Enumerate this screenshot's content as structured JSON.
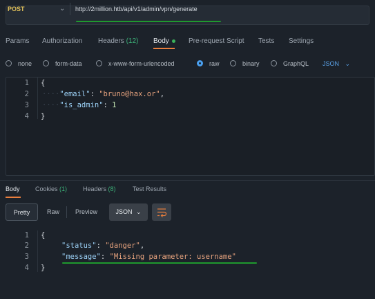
{
  "request": {
    "method": "POST",
    "url": "http://2million.htb/api/v1/admin/vpn/generate"
  },
  "tabs": {
    "params": "Params",
    "authorization": "Authorization",
    "headers_label": "Headers",
    "headers_count": "(12)",
    "body": "Body",
    "prerequest": "Pre-request Script",
    "tests": "Tests",
    "settings": "Settings"
  },
  "body_types": {
    "none": "none",
    "form_data": "form-data",
    "urlencoded": "x-www-form-urlencoded",
    "raw": "raw",
    "binary": "binary",
    "graphql": "GraphQL",
    "format": "JSON",
    "selected": "raw"
  },
  "request_body": {
    "line_numbers": [
      "1",
      "2",
      "3",
      "4"
    ],
    "open_brace": "{",
    "close_brace": "}",
    "email_key": "\"email\"",
    "email_value": "\"bruno@hax.or\"",
    "is_admin_key": "\"is_admin\"",
    "is_admin_value": "1"
  },
  "response_tabs": {
    "body": "Body",
    "cookies_label": "Cookies",
    "cookies_count": "(1)",
    "headers_label": "Headers",
    "headers_count": "(8)",
    "test_results": "Test Results"
  },
  "response_view": {
    "pretty": "Pretty",
    "raw": "Raw",
    "preview": "Preview",
    "format": "JSON"
  },
  "response_body": {
    "line_numbers": [
      "1",
      "2",
      "3",
      "4"
    ],
    "open_brace": "{",
    "close_brace": "}",
    "status_key": "\"status\"",
    "status_value": "\"danger\"",
    "message_key": "\"message\"",
    "message_value": "\"Missing parameter: username\""
  },
  "icons": {
    "method_dropdown": "chevron-down-icon",
    "format_dropdown": "chevron-down-icon",
    "wrap": "wrap-lines-icon"
  },
  "colors": {
    "method": "#e2c25a",
    "active_tab_underline": "#e97e3d",
    "highlight_underline": "#1f9a2e",
    "count": "#3db37a",
    "json_key": "#9bd0f5",
    "json_string": "#e7a37e",
    "json_number": "#c4e7b3"
  }
}
